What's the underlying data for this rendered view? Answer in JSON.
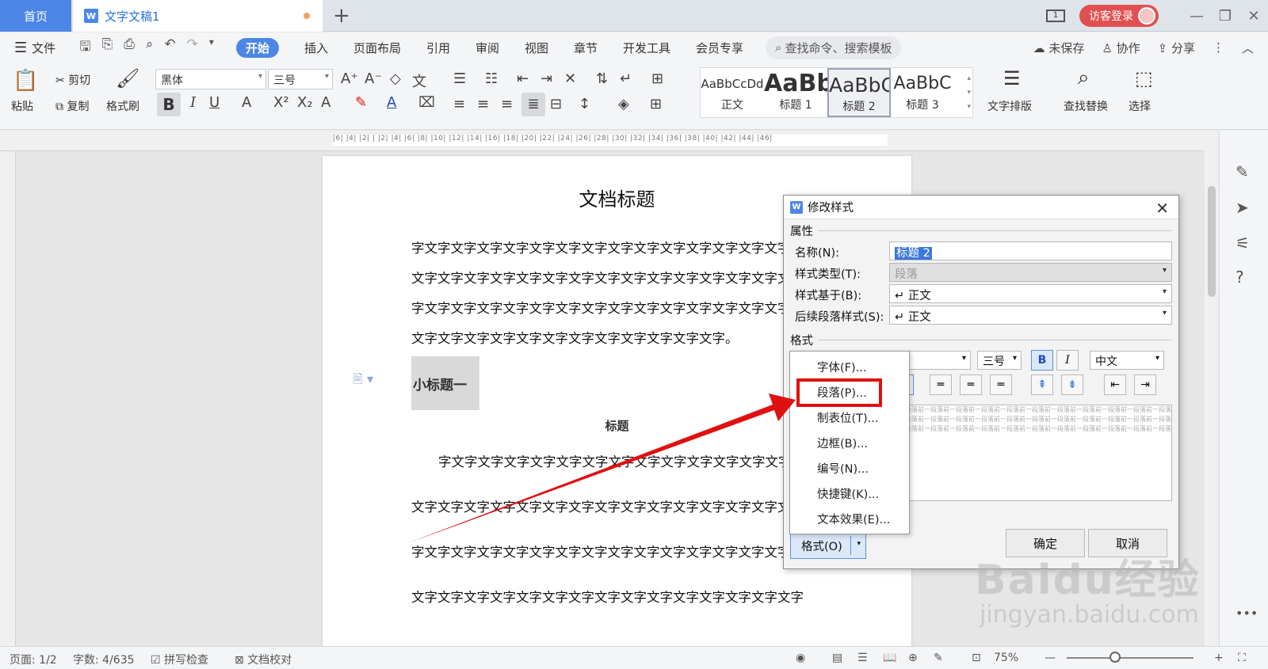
{
  "tabbar": {
    "home": "首页",
    "doc": "文字文稿1",
    "page_icon": "1",
    "login": "访客登录"
  },
  "menubar": {
    "file": "文件",
    "items": [
      "开始",
      "插入",
      "页面布局",
      "引用",
      "审阅",
      "视图",
      "章节",
      "开发工具",
      "会员专享"
    ],
    "search": "查找命令、搜索模板",
    "unsaved": "未保存",
    "collab": "协作",
    "share": "分享"
  },
  "ribbon": {
    "paste": "粘贴",
    "cut": "剪切",
    "copy": "复制",
    "format_painter": "格式刷",
    "font_name": "黑体",
    "font_size": "三号",
    "styles": [
      {
        "sample": "AaBbCcDd",
        "name": "正文"
      },
      {
        "sample": "AaBb",
        "name": "标题 1"
      },
      {
        "sample": "AaBbC",
        "name": "标题 2"
      },
      {
        "sample": "AaBbC",
        "name": "标题 3"
      }
    ],
    "text_layout": "文字排版",
    "find_replace": "查找替换",
    "select": "选择"
  },
  "ruler_ticks": "|6| |4| |2| | |2| |4| |6| |8| |10| |12| |14| |16| |18| |20| |22| |24| |26| |28| |30| |32| |34| |36| |38| |40| |42| |44| |46|",
  "document": {
    "title": "文档标题",
    "lines": [
      "字文字文字文字文字文字文字文字文字文字文字文字文字文字文字",
      "文字文字文字文字文字文字文字文字文字文字文字文字文字文字文字",
      "字文字文字文字文字文字文字文字文字文字文字文字文字文字文字",
      "文字文字文字文字文字文字文字文字文字文字文字文字。"
    ],
    "subheading": "小标题一",
    "heading": "标题",
    "lines2": [
      "字文字文字文字文字文字文字文字文字文字文字文字文字文字",
      "文字文字文字文字文字文字文字文字文字文字文字文字文字文字文字",
      "字文字文字文字文字文字文字文字文字文字文字文字文字文字文字",
      "文字文字文字文字文字文字文字文字文字文字文字文字文字文字文字"
    ]
  },
  "dialog": {
    "title": "修改样式",
    "section_props": "属性",
    "name_label": "名称(N):",
    "name_value": "标题 2",
    "type_label": "样式类型(T):",
    "type_value": "段落",
    "based_label": "样式基于(B):",
    "based_value": "↵ 正文",
    "next_label": "后续段落样式(S):",
    "next_value": "↵ 正文",
    "section_format": "格式",
    "size": "三号",
    "script": "中文",
    "bold": "B",
    "italic": "I",
    "preview_text": "段落前一段落前一段落前一段落前一段落前一段落前一段落前一段落前一段落前一段落前一段落",
    "format_button": "格式(O)",
    "ok": "确定",
    "cancel": "取消"
  },
  "format_menu": [
    "字体(F)...",
    "段落(P)...",
    "制表位(T)...",
    "边框(B)...",
    "编号(N)...",
    "快捷键(K)...",
    "文本效果(E)..."
  ],
  "statusbar": {
    "page": "页面: 1/2",
    "words": "字数: 4/635",
    "spell": "拼写检查",
    "proof": "文档校对",
    "zoom": "75%"
  },
  "watermark": {
    "brand": "Baidu经验",
    "url": "jingyan.baidu.com"
  },
  "colors": {
    "accent": "#4c86e7",
    "highlight": "#e01010",
    "login": "#e05050"
  }
}
